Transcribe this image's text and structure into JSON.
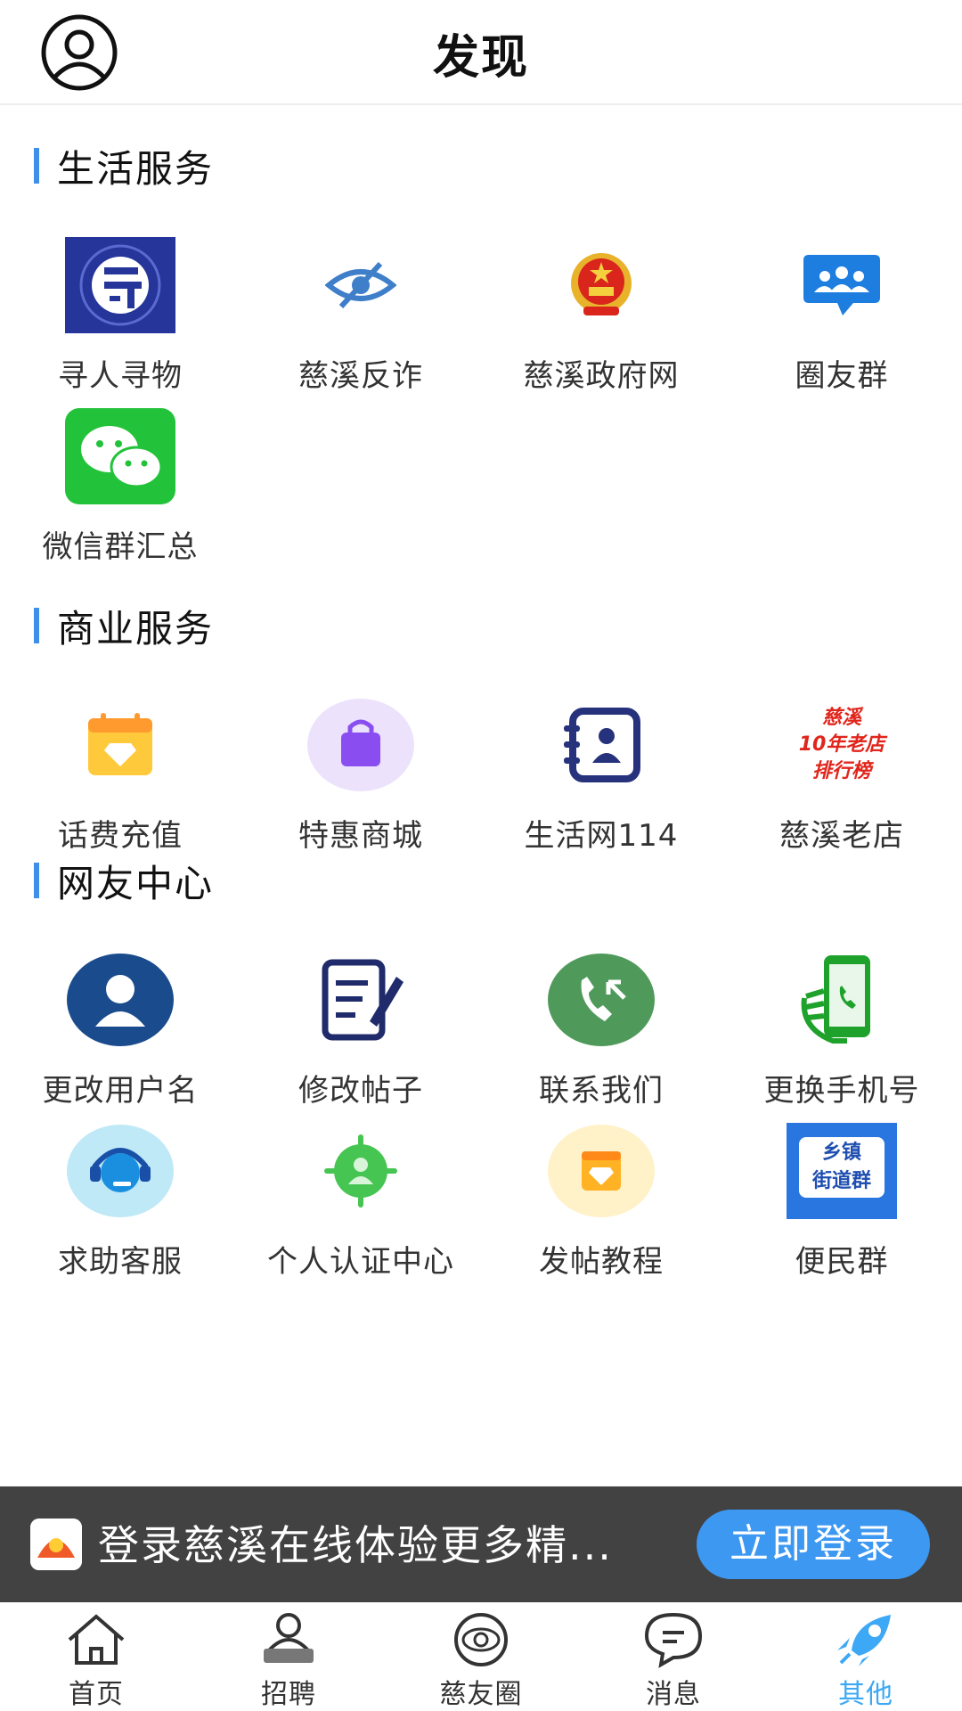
{
  "header": {
    "title": "发现",
    "avatar_icon": "user-circle-icon"
  },
  "sections": [
    {
      "title": "生活服务",
      "items": [
        {
          "label": "寻人寻物",
          "icon": "find-person-icon"
        },
        {
          "label": "慈溪反诈",
          "icon": "anti-fraud-eye-icon"
        },
        {
          "label": "慈溪政府网",
          "icon": "national-emblem-icon"
        },
        {
          "label": "圈友群",
          "icon": "group-chat-icon"
        },
        {
          "label": "微信群汇总",
          "icon": "wechat-icon"
        }
      ]
    },
    {
      "title": "商业服务",
      "items": [
        {
          "label": "话费充值",
          "icon": "recharge-calendar-icon"
        },
        {
          "label": "特惠商城",
          "icon": "shopping-bag-icon"
        },
        {
          "label": "生活网114",
          "icon": "contact-book-icon"
        },
        {
          "label": "慈溪老店",
          "icon": "old-shop-ranking-icon",
          "badge_lines": [
            "慈溪",
            "10年老店",
            "排行榜"
          ]
        }
      ]
    },
    {
      "title": "网友中心",
      "items": [
        {
          "label": "更改用户名",
          "icon": "user-profile-icon"
        },
        {
          "label": "修改帖子",
          "icon": "edit-post-icon"
        },
        {
          "label": "联系我们",
          "icon": "phone-call-icon"
        },
        {
          "label": "更换手机号",
          "icon": "hand-phone-icon"
        },
        {
          "label": "求助客服",
          "icon": "headset-icon"
        },
        {
          "label": "个人认证中心",
          "icon": "certification-icon"
        },
        {
          "label": "发帖教程",
          "icon": "tutorial-icon"
        },
        {
          "label": "便民群",
          "icon": "town-group-icon",
          "badge_lines": [
            "乡镇",
            "街道群"
          ]
        }
      ]
    }
  ],
  "login_banner": {
    "text": "登录慈溪在线体验更多精...",
    "button": "立即登录"
  },
  "tabbar": {
    "active_color": "#3da8f5",
    "tabs": [
      {
        "label": "首页",
        "icon": "home-icon"
      },
      {
        "label": "招聘",
        "icon": "recruit-icon"
      },
      {
        "label": "慈友圈",
        "icon": "circle-planet-icon"
      },
      {
        "label": "消息",
        "icon": "message-bubble-icon"
      },
      {
        "label": "其他",
        "icon": "rocket-icon",
        "active": true
      }
    ]
  },
  "colors": {
    "accent": "#3d8fe8",
    "banner_bg": "#323232",
    "login_button": "#3d98f2"
  }
}
